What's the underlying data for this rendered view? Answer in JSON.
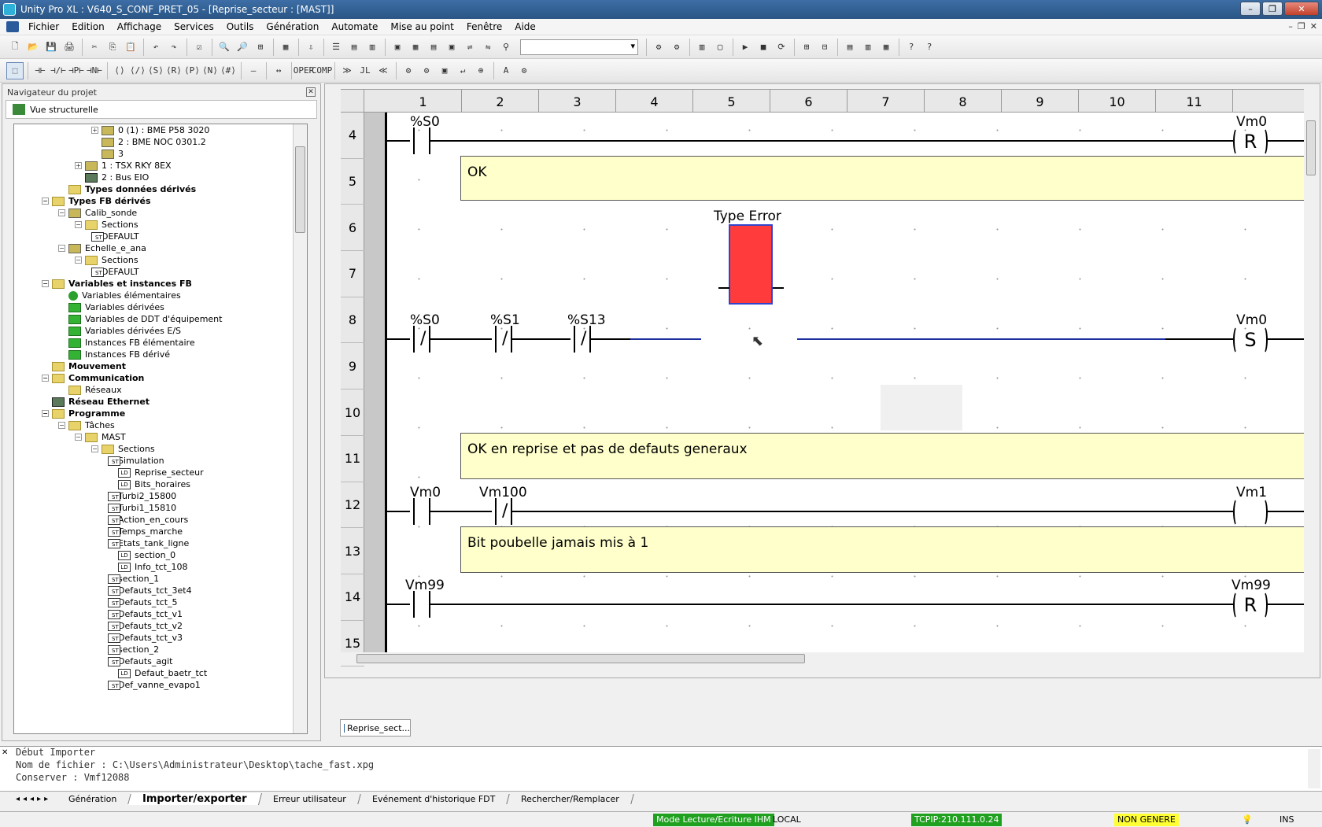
{
  "window": {
    "title": "Unity Pro XL : V640_S_CONF_PRET_05 - [Reprise_secteur : [MAST]]",
    "buttons": [
      "–",
      "❐",
      "✕"
    ]
  },
  "menu": [
    "Fichier",
    "Edition",
    "Affichage",
    "Services",
    "Outils",
    "Génération",
    "Automate",
    "Mise au point",
    "Fenêtre",
    "Aide"
  ],
  "mdi_buttons": [
    "–",
    "❐",
    "✕"
  ],
  "toolbar1": [
    "🗋",
    "📂",
    "💾",
    "🖨",
    "|",
    "✂",
    "⎘",
    "📋",
    "|",
    "↶",
    "↷",
    "|",
    "☑",
    "|",
    "🔍",
    "🔎",
    "⊞",
    "|",
    "▦",
    "|",
    "⇩",
    "|",
    "☰",
    "▤",
    "▥",
    "|",
    "▣",
    "▦",
    "▤",
    "▣",
    "⇌",
    "⇋",
    "⚲",
    "COMBO",
    "|",
    "⚙",
    "⚙",
    "|",
    "▥",
    "▢",
    "|",
    "▶",
    "■",
    "⟳",
    "|",
    "⊞",
    "⊟",
    "|",
    "▤",
    "▥",
    "▦",
    "|",
    "?",
    "?"
  ],
  "toolbar2": [
    "⬚",
    "|",
    "⊣⊢",
    "⊣/⊢",
    "⊣P⊢",
    "⊣N⊢",
    "|",
    "⟨⟩",
    "⟨/⟩",
    "⟨S⟩",
    "⟨R⟩",
    "⟨P⟩",
    "⟨N⟩",
    "⟨#⟩",
    "|",
    "—",
    "|",
    "↔",
    "|",
    "OPER",
    "COMP",
    "|",
    "≫",
    "JL",
    "≪",
    "|",
    "⚙",
    "⚙",
    "▣",
    "↵",
    "⊕",
    "|",
    "A",
    "⚙"
  ],
  "navigator": {
    "title": "Navigateur du projet",
    "view": "Vue structurelle",
    "items": [
      {
        "level": 4,
        "exp": "+",
        "icon": "mod",
        "label": "0 (1) : BME P58 3020",
        "bold": false
      },
      {
        "level": 4,
        "exp": "",
        "icon": "mod",
        "label": "2 : BME NOC 0301.2",
        "bold": false
      },
      {
        "level": 4,
        "exp": "",
        "icon": "mod",
        "label": "3",
        "bold": false
      },
      {
        "level": 3,
        "exp": "+",
        "icon": "mod",
        "label": "1 : TSX RKY 8EX",
        "bold": false
      },
      {
        "level": 3,
        "exp": "",
        "icon": "net",
        "label": "2 : Bus EIO",
        "bold": false
      },
      {
        "level": 2,
        "exp": "",
        "icon": "folder",
        "label": "Types données dérivés",
        "bold": true
      },
      {
        "level": 1,
        "exp": "−",
        "icon": "folder",
        "label": "Types FB dérivés",
        "bold": true
      },
      {
        "level": 2,
        "exp": "−",
        "icon": "mod",
        "label": "Calib_sonde",
        "bold": false
      },
      {
        "level": 3,
        "exp": "−",
        "icon": "folder",
        "label": "Sections",
        "bold": false
      },
      {
        "level": 4,
        "exp": "",
        "icon": "st",
        "label": "DEFAULT",
        "bold": false
      },
      {
        "level": 2,
        "exp": "−",
        "icon": "mod",
        "label": "Echelle_e_ana",
        "bold": false
      },
      {
        "level": 3,
        "exp": "−",
        "icon": "folder",
        "label": "Sections",
        "bold": false
      },
      {
        "level": 4,
        "exp": "",
        "icon": "st",
        "label": "DEFAULT",
        "bold": false
      },
      {
        "level": 1,
        "exp": "−",
        "icon": "folder",
        "label": "Variables et instances FB",
        "bold": true
      },
      {
        "level": 2,
        "exp": "",
        "icon": "green",
        "label": "Variables élémentaires",
        "bold": false
      },
      {
        "level": 2,
        "exp": "",
        "icon": "greensq",
        "label": "Variables dérivées",
        "bold": false
      },
      {
        "level": 2,
        "exp": "",
        "icon": "greensq",
        "label": "Variables de DDT d'équipement",
        "bold": false
      },
      {
        "level": 2,
        "exp": "",
        "icon": "greensq",
        "label": "Variables dérivées E/S",
        "bold": false
      },
      {
        "level": 2,
        "exp": "",
        "icon": "greensq",
        "label": "Instances FB élémentaire",
        "bold": false
      },
      {
        "level": 2,
        "exp": "",
        "icon": "greensq",
        "label": "Instances FB dérivé",
        "bold": false
      },
      {
        "level": 1,
        "exp": "",
        "icon": "folder",
        "label": "Mouvement",
        "bold": true
      },
      {
        "level": 1,
        "exp": "−",
        "icon": "folder",
        "label": "Communication",
        "bold": true
      },
      {
        "level": 2,
        "exp": "",
        "icon": "folder",
        "label": "Réseaux",
        "bold": false
      },
      {
        "level": 1,
        "exp": "",
        "icon": "net",
        "label": "Réseau Ethernet",
        "bold": true
      },
      {
        "level": 1,
        "exp": "−",
        "icon": "folder",
        "label": "Programme",
        "bold": true
      },
      {
        "level": 2,
        "exp": "−",
        "icon": "folder",
        "label": "Tâches",
        "bold": false
      },
      {
        "level": 3,
        "exp": "−",
        "icon": "folder",
        "label": "MAST",
        "bold": false
      },
      {
        "level": 4,
        "exp": "−",
        "icon": "folder",
        "label": "Sections",
        "bold": false
      },
      {
        "level": 5,
        "exp": "",
        "icon": "st",
        "label": "Simulation",
        "bold": false
      },
      {
        "level": 5,
        "exp": "",
        "icon": "ld",
        "label": "Reprise_secteur",
        "bold": false
      },
      {
        "level": 5,
        "exp": "",
        "icon": "ld",
        "label": "Bits_horaires",
        "bold": false
      },
      {
        "level": 5,
        "exp": "",
        "icon": "st",
        "label": "Turbi2_15800",
        "bold": false
      },
      {
        "level": 5,
        "exp": "",
        "icon": "st",
        "label": "Turbi1_15810",
        "bold": false
      },
      {
        "level": 5,
        "exp": "",
        "icon": "st",
        "label": "Action_en_cours",
        "bold": false
      },
      {
        "level": 5,
        "exp": "",
        "icon": "st",
        "label": "Temps_marche",
        "bold": false
      },
      {
        "level": 5,
        "exp": "",
        "icon": "st",
        "label": "Etats_tank_ligne",
        "bold": false
      },
      {
        "level": 5,
        "exp": "",
        "icon": "ld",
        "label": "section_0",
        "bold": false
      },
      {
        "level": 5,
        "exp": "",
        "icon": "ld",
        "label": "Info_tct_108",
        "bold": false
      },
      {
        "level": 5,
        "exp": "",
        "icon": "st",
        "label": "section_1",
        "bold": false
      },
      {
        "level": 5,
        "exp": "",
        "icon": "st",
        "label": "Defauts_tct_3et4",
        "bold": false
      },
      {
        "level": 5,
        "exp": "",
        "icon": "st",
        "label": "Defauts_tct_5",
        "bold": false
      },
      {
        "level": 5,
        "exp": "",
        "icon": "st",
        "label": "Defauts_tct_v1",
        "bold": false
      },
      {
        "level": 5,
        "exp": "",
        "icon": "st",
        "label": "Defauts_tct_v2",
        "bold": false
      },
      {
        "level": 5,
        "exp": "",
        "icon": "st",
        "label": "Defauts_tct_v3",
        "bold": false
      },
      {
        "level": 5,
        "exp": "",
        "icon": "st",
        "label": "section_2",
        "bold": false
      },
      {
        "level": 5,
        "exp": "",
        "icon": "st",
        "label": "Defauts_agit",
        "bold": false
      },
      {
        "level": 5,
        "exp": "",
        "icon": "ld",
        "label": "Defaut_baetr_tct",
        "bold": false
      },
      {
        "level": 5,
        "exp": "",
        "icon": "st",
        "label": "Def_vanne_evapo1",
        "bold": false
      }
    ]
  },
  "editor": {
    "columns": [
      "1",
      "2",
      "3",
      "4",
      "5",
      "6",
      "7",
      "8",
      "9",
      "10",
      "11"
    ],
    "rows": [
      "4",
      "5",
      "6",
      "7",
      "8",
      "9",
      "10",
      "11",
      "12",
      "13",
      "14",
      "15"
    ],
    "comments": {
      "c5": "OK",
      "c11": "OK en reprise et pas de defauts generaux",
      "c13": "Bit poubelle jamais mis à 1"
    },
    "fb_label": "Type Error",
    "labels": {
      "r4_c1": "%S0",
      "r4_coil": "Vm0",
      "r4_coil_type": "R",
      "r8_c1": "%S0",
      "r8_c2": "%S1",
      "r8_c3": "%S13",
      "r8_coil": "Vm0",
      "r8_coil_type": "S",
      "r12_c1": "Vm0",
      "r12_c2": "Vm100",
      "r12_coil": "Vm1",
      "r12_coil_type": "",
      "r14_c1": "Vm99",
      "r14_coil": "Vm99",
      "r14_coil_type": "R"
    },
    "fb_color": "#ff3b3b",
    "comment_color": "#ffffcc"
  },
  "doc_tab": "Reprise_sect...",
  "output": {
    "lines": [
      "Début Importer",
      "Nom de fichier : C:\\Users\\Administrateur\\Desktop\\tache_fast.xpg",
      "Conserver : Vmf12088"
    ],
    "tabs": [
      "Génération",
      "Importer/exporter",
      "Erreur utilisateur",
      "Evénement d'historique FDT",
      "Rechercher/Remplacer"
    ],
    "active_tab": "Importer/exporter"
  },
  "status": {
    "mode": "Mode Lecture/Ecriture IHM",
    "local": "LOCAL",
    "tcpip": "TCPIP:210.111.0.24",
    "gen": "NON GENERE",
    "ins": "INS",
    "mode_color": "#1fa01f",
    "tcpip_color": "#1fa01f",
    "gen_color": "#ffff33"
  }
}
